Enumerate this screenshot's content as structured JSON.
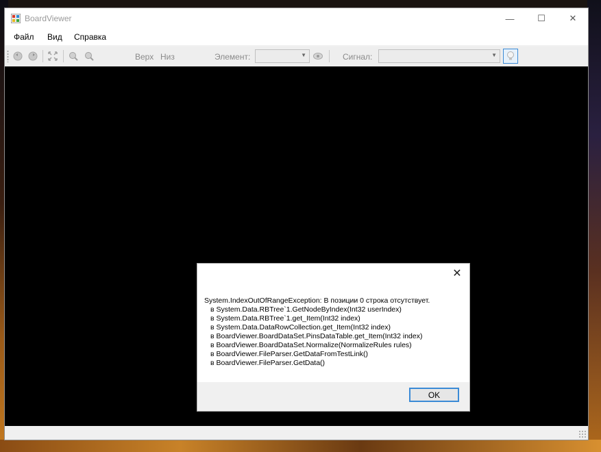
{
  "window": {
    "title": "BoardViewer"
  },
  "menu": {
    "items": [
      "Файл",
      "Вид",
      "Справка"
    ]
  },
  "toolbar": {
    "top_label": "Верх",
    "bottom_label": "Низ",
    "element_label": "Элемент:",
    "element_value": "",
    "signal_label": "Сигнал:",
    "signal_value": ""
  },
  "dialog": {
    "lines": [
      "System.IndexOutOfRangeException: В позиции 0 строка отсутствует.",
      "   в System.Data.RBTree`1.GetNodeByIndex(Int32 userIndex)",
      "   в System.Data.RBTree`1.get_Item(Int32 index)",
      "   в System.Data.DataRowCollection.get_Item(Int32 index)",
      "   в BoardViewer.BoardDataSet.PinsDataTable.get_Item(Int32 index)",
      "   в BoardViewer.BoardDataSet.Normalize(NormalizeRules rules)",
      "   в BoardViewer.FileParser.GetDataFromTestLink()",
      "   в BoardViewer.FileParser.GetData()"
    ],
    "ok_label": "OK"
  },
  "icons": {
    "close": "✕",
    "minimize": "—",
    "maximize": "☐"
  },
  "colors": {
    "accent": "#3a8ad6",
    "canvas": "#000000"
  }
}
